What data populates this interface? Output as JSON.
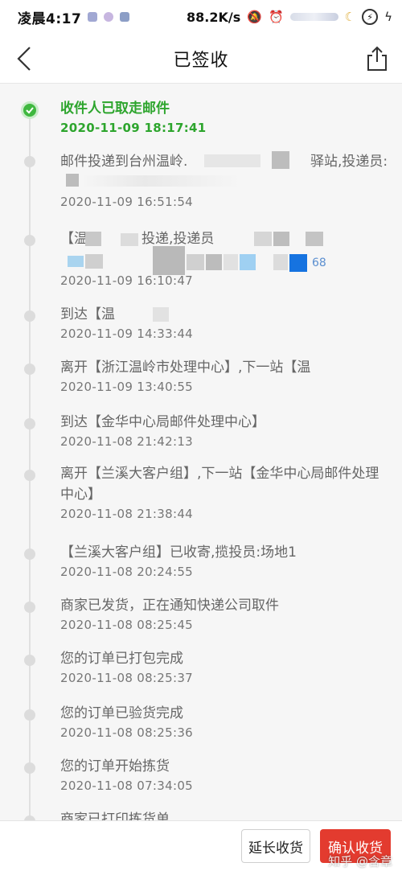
{
  "status_bar": {
    "time": "凌晨4:17",
    "speed": "88.2K/s",
    "icons": [
      "mute-icon",
      "alarm-icon",
      "signal-icon",
      "moon-icon",
      "battery-icon",
      "charging-icon"
    ]
  },
  "nav": {
    "title": "已签收",
    "back_icon": "back-chevron-icon",
    "share_icon": "share-icon"
  },
  "events": [
    {
      "text": "收件人已取走邮件",
      "time": "2020-11-09 18:17:41",
      "status": "active"
    },
    {
      "text": "邮件投递到台州温岭.",
      "text_tail": "驿站,投递员:",
      "time": "2020-11-09 16:51:54",
      "status": "done"
    },
    {
      "text": "【温",
      "text_tail": "投递,投递员",
      "text_line2_tail": "68",
      "time": "2020-11-09 16:10:47",
      "status": "done"
    },
    {
      "text": "到达【温",
      "time": "2020-11-09 14:33:44",
      "status": "done"
    },
    {
      "text": "离开【浙江温岭市处理中心】,下一站【温",
      "time": "2020-11-09 13:40:55",
      "status": "done"
    },
    {
      "text": "到达【金华中心局邮件处理中心】",
      "time": "2020-11-08 21:42:13",
      "status": "done"
    },
    {
      "text": "离开【兰溪大客户组】,下一站【金华中心局邮件处理中心】",
      "time": "2020-11-08 21:38:44",
      "status": "done"
    },
    {
      "text": "【兰溪大客户组】已收寄,揽投员:场地1",
      "time": "2020-11-08 20:24:55",
      "status": "done"
    },
    {
      "text": "商家已发货，正在通知快递公司取件",
      "time": "2020-11-08 08:25:45",
      "status": "done"
    },
    {
      "text": "您的订单已打包完成",
      "time": "2020-11-08 08:25:37",
      "status": "done"
    },
    {
      "text": "您的订单已验货完成",
      "time": "2020-11-08 08:25:36",
      "status": "done"
    },
    {
      "text": "您的订单开始拣货",
      "time": "2020-11-08 07:34:05",
      "status": "done"
    },
    {
      "text": "商家已打印拣货单",
      "time": "",
      "status": "done"
    }
  ],
  "bottom": {
    "extend_label": "延长收货",
    "confirm_label": "确认收货"
  },
  "watermark": "知乎 @含章",
  "colors": {
    "active_green": "#2da52d",
    "confirm_red": "#e33b2f"
  }
}
